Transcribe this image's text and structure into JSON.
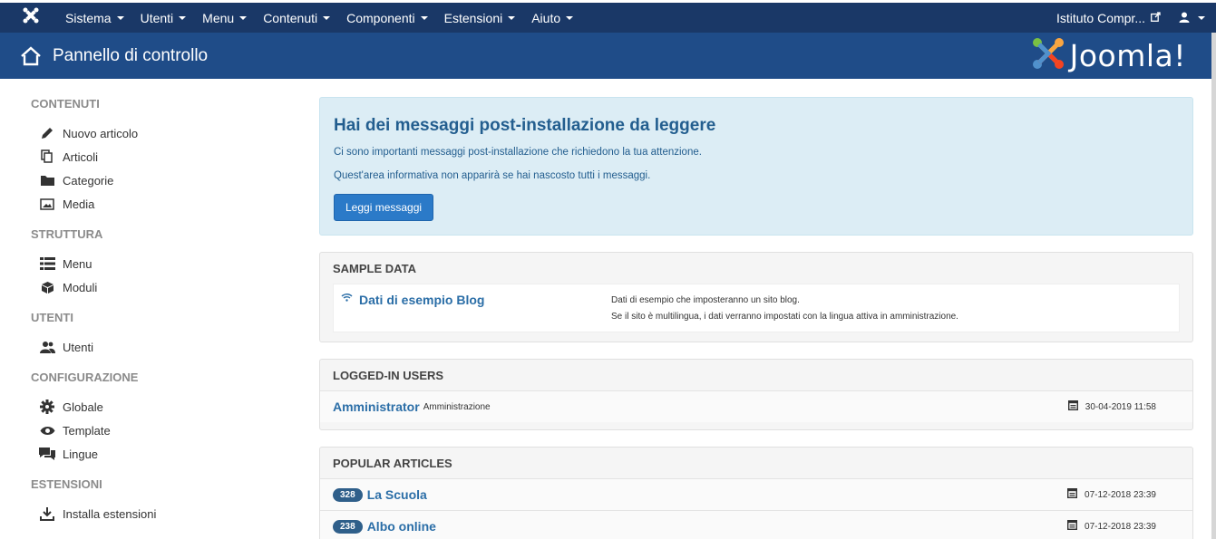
{
  "topbar": {
    "logo_icon": "joomla-icon",
    "menu": [
      {
        "label": "Sistema"
      },
      {
        "label": "Utenti"
      },
      {
        "label": "Menu"
      },
      {
        "label": "Contenuti"
      },
      {
        "label": "Componenti"
      },
      {
        "label": "Estensioni"
      },
      {
        "label": "Aiuto"
      }
    ],
    "site_link": "Istituto Compr...",
    "colors": {
      "bar": "#1a3867",
      "header": "#1f4c88"
    }
  },
  "header": {
    "title": "Pannello di controllo",
    "brand": "Joomla!"
  },
  "sidebar": {
    "sections": [
      {
        "title": "CONTENUTI",
        "items": [
          {
            "label": "Nuovo articolo",
            "icon": "pencil-icon"
          },
          {
            "label": "Articoli",
            "icon": "copy-icon"
          },
          {
            "label": "Categorie",
            "icon": "folder-icon"
          },
          {
            "label": "Media",
            "icon": "image-icon"
          }
        ]
      },
      {
        "title": "STRUTTURA",
        "items": [
          {
            "label": "Menu",
            "icon": "list-icon"
          },
          {
            "label": "Moduli",
            "icon": "cube-icon"
          }
        ]
      },
      {
        "title": "UTENTI",
        "items": [
          {
            "label": "Utenti",
            "icon": "users-icon"
          }
        ]
      },
      {
        "title": "CONFIGURAZIONE",
        "items": [
          {
            "label": "Globale",
            "icon": "cog-icon"
          },
          {
            "label": "Template",
            "icon": "eye-icon"
          },
          {
            "label": "Lingue",
            "icon": "comments-icon"
          }
        ]
      },
      {
        "title": "ESTENSIONI",
        "items": [
          {
            "label": "Installa estensioni",
            "icon": "download-icon"
          }
        ]
      }
    ]
  },
  "alert": {
    "title": "Hai dei messaggi post-installazione da leggere",
    "text1": "Ci sono importanti messaggi post-installazione che richiedono la tua attenzione.",
    "text2": "Quest'area informativa non apparirà se hai nascosto tutti i messaggi.",
    "button": "Leggi messaggi"
  },
  "sample_data": {
    "title": "SAMPLE DATA",
    "item_label": "Dati di esempio Blog",
    "desc1": "Dati di esempio che imposteranno un sito blog.",
    "desc2": "Se il sito è multilingua, i dati verranno impostati con la lingua attiva in amministrazione."
  },
  "logged_users": {
    "title": "LOGGED-IN USERS",
    "rows": [
      {
        "name": "Amministrator",
        "role": "Amministrazione",
        "date": "30-04-2019 11:58"
      }
    ]
  },
  "popular": {
    "title": "POPULAR ARTICLES",
    "rows": [
      {
        "hits": "328",
        "title": "La Scuola",
        "date": "07-12-2018 23:39"
      },
      {
        "hits": "238",
        "title": "Albo online",
        "date": "07-12-2018 23:39"
      }
    ]
  }
}
